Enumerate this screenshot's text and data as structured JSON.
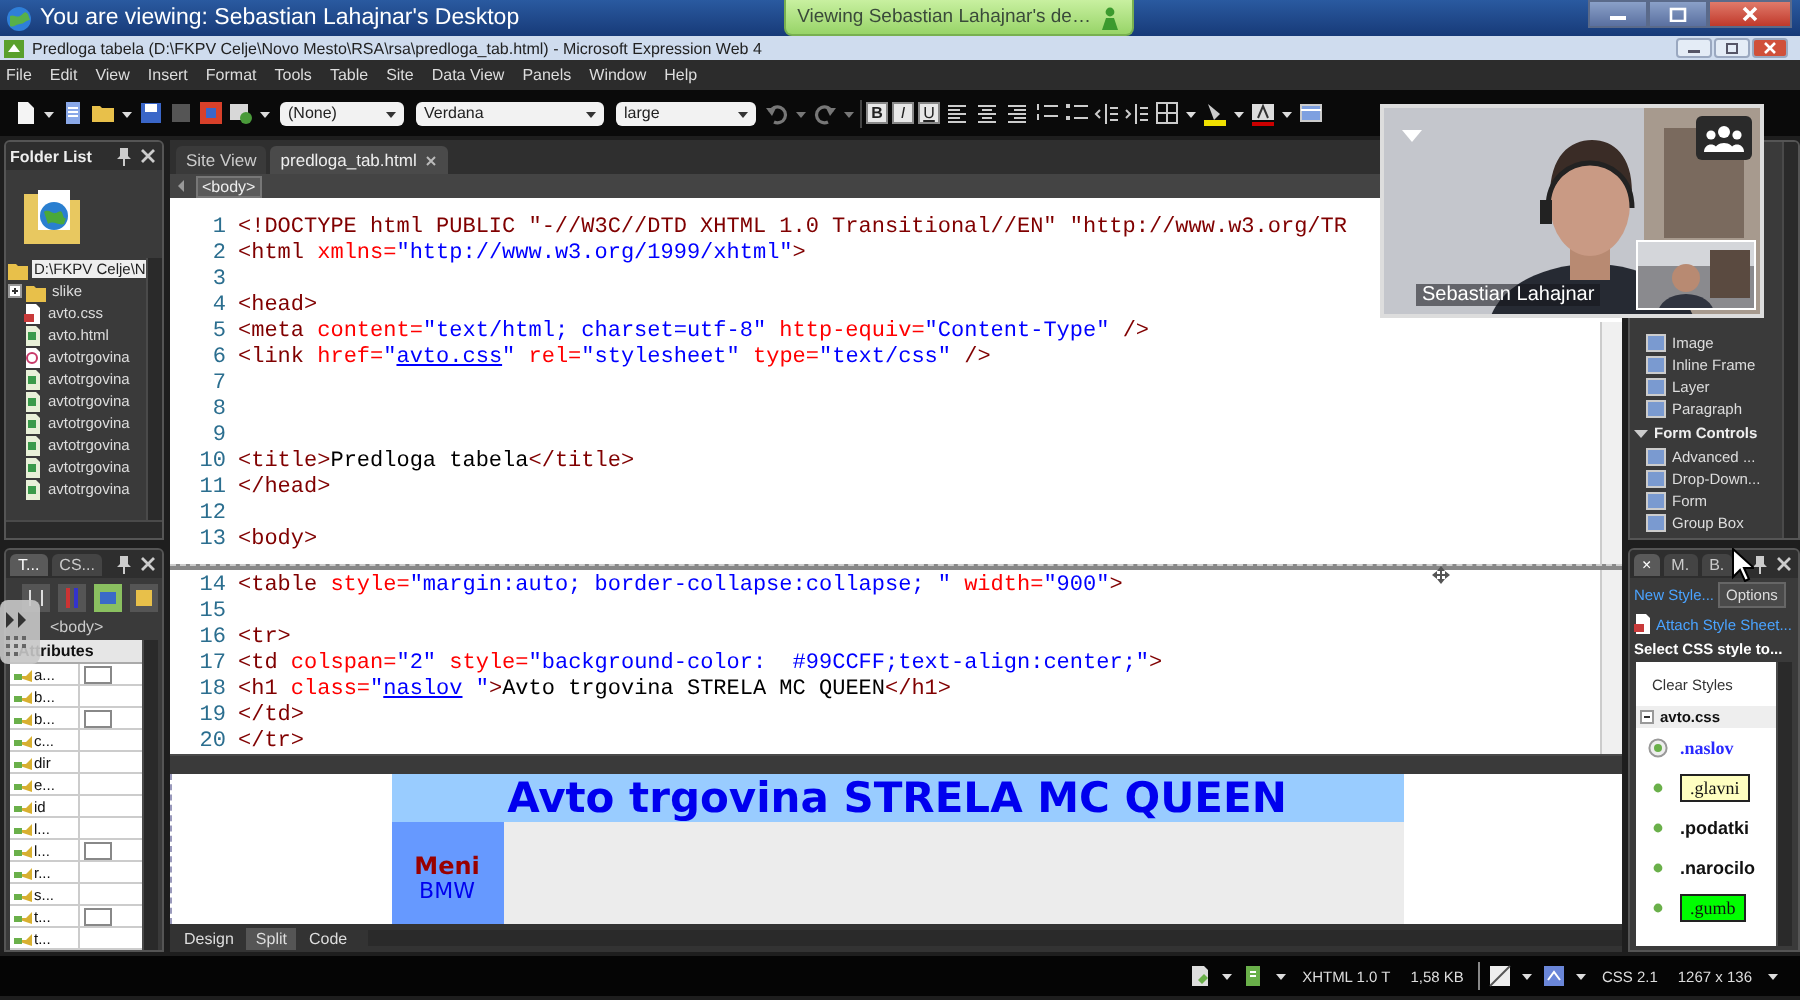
{
  "viewer_bar": {
    "title": "You are viewing: Sebastian Lahajnar's Desktop",
    "notification": "Viewing Sebastian Lahajnar's de…"
  },
  "window": {
    "title": "Predloga tabela (D:\\FKPV Celje\\Novo Mesto\\RSA\\rsa\\predloga_tab.html) - Microsoft Expression Web 4"
  },
  "menu": [
    "File",
    "Edit",
    "View",
    "Insert",
    "Format",
    "Tools",
    "Table",
    "Site",
    "Data View",
    "Panels",
    "Window",
    "Help"
  ],
  "toolbar": {
    "style": "(None)",
    "font": "Verdana",
    "size": "large",
    "format_buttons": [
      "B",
      "I",
      "U"
    ]
  },
  "folder_list": {
    "title": "Folder List",
    "items": [
      {
        "label": "D:\\FKPV Celje\\N",
        "kind": "root",
        "selected": true
      },
      {
        "label": "slike",
        "kind": "folder",
        "selected": false
      },
      {
        "label": "avto.css",
        "kind": "css",
        "selected": false
      },
      {
        "label": "avto.html",
        "kind": "html",
        "selected": false
      },
      {
        "label": "avtotrgovina",
        "kind": "other",
        "selected": false
      },
      {
        "label": "avtotrgovina",
        "kind": "html",
        "selected": false
      },
      {
        "label": "avtotrgovina",
        "kind": "html",
        "selected": false
      },
      {
        "label": "avtotrgovina",
        "kind": "html",
        "selected": false
      },
      {
        "label": "avtotrgovina",
        "kind": "html",
        "selected": false
      },
      {
        "label": "avtotrgovina",
        "kind": "html",
        "selected": false
      },
      {
        "label": "avtotrgovina",
        "kind": "html",
        "selected": false
      }
    ]
  },
  "tag_panel": {
    "tabs": [
      {
        "label": "T...",
        "selected": true
      },
      {
        "label": "CS...",
        "selected": false
      }
    ],
    "tag": "<body>",
    "column": "Attributes",
    "attributes": [
      {
        "name": "a...",
        "kind": "swatch"
      },
      {
        "name": "b...",
        "kind": "plain"
      },
      {
        "name": "b...",
        "kind": "swatch"
      },
      {
        "name": "c...",
        "kind": "plain"
      },
      {
        "name": "dir",
        "kind": "plain"
      },
      {
        "name": "e...",
        "kind": "plain"
      },
      {
        "name": "id",
        "kind": "plain"
      },
      {
        "name": "l...",
        "kind": "plain"
      },
      {
        "name": "l...",
        "kind": "swatch"
      },
      {
        "name": "r...",
        "kind": "plain"
      },
      {
        "name": "s...",
        "kind": "plain"
      },
      {
        "name": "t...",
        "kind": "swatch"
      },
      {
        "name": "t...",
        "kind": "plain"
      }
    ]
  },
  "editor": {
    "tabs": [
      {
        "label": "Site View",
        "selected": false
      },
      {
        "label": "predloga_tab.html",
        "selected": true
      }
    ],
    "breadcrumb": "<body>",
    "top_lines": [
      {
        "number": "1",
        "segments": [
          {
            "kind": "tag",
            "text": "<!DOCTYPE html PUBLIC \"-//W3C//DTD XHTML 1.0 Transitional//EN\" \"http://www.w3.org/TR"
          }
        ]
      },
      {
        "number": "2",
        "segments": [
          {
            "kind": "tag",
            "text": "<html"
          },
          {
            "kind": "attr",
            "text": " xmlns="
          },
          {
            "kind": "value",
            "text": "\"http://www.w3.org/1999/xhtml\""
          },
          {
            "kind": "tag",
            "text": ">"
          }
        ]
      },
      {
        "number": "3"
      },
      {
        "number": "4",
        "segments": [
          {
            "kind": "tag",
            "text": "<head>"
          }
        ]
      },
      {
        "number": "5",
        "segments": [
          {
            "kind": "tag",
            "text": "<meta"
          },
          {
            "kind": "attr",
            "text": " content="
          },
          {
            "kind": "value",
            "text": "\"text/html; charset=utf-8\""
          },
          {
            "kind": "attr",
            "text": " http-equiv="
          },
          {
            "kind": "value",
            "text": "\"Content-Type\""
          },
          {
            "kind": "tag",
            "text": " />"
          }
        ]
      },
      {
        "number": "6",
        "segments": [
          {
            "kind": "tag",
            "text": "<link"
          },
          {
            "kind": "attr",
            "text": " href="
          },
          {
            "kind": "value",
            "text": "\""
          },
          {
            "kind": "link",
            "text": "avto.css"
          },
          {
            "kind": "value",
            "text": "\""
          },
          {
            "kind": "attr",
            "text": " rel="
          },
          {
            "kind": "value",
            "text": "\"stylesheet\""
          },
          {
            "kind": "attr",
            "text": " type="
          },
          {
            "kind": "value",
            "text": "\"text/css\""
          },
          {
            "kind": "tag",
            "text": " />"
          }
        ]
      },
      {
        "number": "7"
      },
      {
        "number": "8"
      },
      {
        "number": "9"
      },
      {
        "number": "10",
        "segments": [
          {
            "kind": "tag",
            "text": "<title>"
          },
          {
            "kind": "text",
            "text": "Predloga tabela"
          },
          {
            "kind": "tag",
            "text": "</title>"
          }
        ]
      },
      {
        "number": "11",
        "segments": [
          {
            "kind": "tag",
            "text": "</head>"
          }
        ]
      },
      {
        "number": "12"
      },
      {
        "number": "13",
        "segments": [
          {
            "kind": "tag",
            "text": "<body>"
          }
        ]
      }
    ],
    "bottom_lines": [
      {
        "number": "14",
        "segments": [
          {
            "kind": "tag",
            "text": "<table"
          },
          {
            "kind": "attr",
            "text": " style="
          },
          {
            "kind": "value",
            "text": "\"margin:auto; border-collapse:collapse; \""
          },
          {
            "kind": "attr",
            "text": " width="
          },
          {
            "kind": "value",
            "text": "\"900\""
          },
          {
            "kind": "tag",
            "text": ">"
          }
        ]
      },
      {
        "number": "15"
      },
      {
        "number": "16",
        "segments": [
          {
            "kind": "tag",
            "text": "<tr>"
          }
        ]
      },
      {
        "number": "17",
        "segments": [
          {
            "kind": "tag",
            "text": "<td"
          },
          {
            "kind": "attr",
            "text": " colspan="
          },
          {
            "kind": "value",
            "text": "\"2\""
          },
          {
            "kind": "attr",
            "text": " style="
          },
          {
            "kind": "value",
            "text": "\"background-color:  #99CCFF;text-align:center;\""
          },
          {
            "kind": "tag",
            "text": ">"
          }
        ]
      },
      {
        "number": "18",
        "segments": [
          {
            "kind": "tag",
            "text": "<h1"
          },
          {
            "kind": "attr",
            "text": " class="
          },
          {
            "kind": "value",
            "text": "\""
          },
          {
            "kind": "link",
            "text": "naslov"
          },
          {
            "kind": "value",
            "text": " \""
          },
          {
            "kind": "tag",
            "text": ">"
          },
          {
            "kind": "text",
            "text": "Avto trgovina STRELA MC QUEEN"
          },
          {
            "kind": "tag",
            "text": "</h1>"
          }
        ]
      },
      {
        "number": "19",
        "segments": [
          {
            "kind": "tag",
            "text": "</td>"
          }
        ]
      },
      {
        "number": "20",
        "segments": [
          {
            "kind": "tag",
            "text": "</tr>"
          }
        ]
      }
    ],
    "design": {
      "heading": "Avto trgovina STRELA MC QUEEN",
      "menu_title": "Meni",
      "menu_items": [
        "BMW"
      ]
    },
    "view_tabs": [
      {
        "label": "Design",
        "selected": false
      },
      {
        "label": "Split",
        "selected": true
      },
      {
        "label": "Code",
        "selected": false
      }
    ]
  },
  "video": {
    "caption": "Sebastian Lahajnar"
  },
  "toolbox": {
    "items": [
      "Image",
      "Inline Frame",
      "Layer",
      "Paragraph"
    ],
    "groups": [
      {
        "label": "Form Controls",
        "expanded": true,
        "children": [
          "Advanced ...",
          "Drop-Down...",
          "Form",
          "Group Box"
        ]
      }
    ]
  },
  "styles_panel": {
    "tabs": [
      {
        "label": "×",
        "selected": true
      },
      {
        "label": "M.",
        "selected": false
      },
      {
        "label": "B.",
        "selected": false
      }
    ],
    "new_style": "New Style...",
    "options": "Options",
    "attach": "Attach Style Sheet...",
    "heading": "Select CSS style to...",
    "clear": "Clear Styles",
    "sheet": {
      "name": "avto.css",
      "expanded": true,
      "styles": [
        {
          "label": ".naslov",
          "kind": "title",
          "selected": true
        },
        {
          "label": ".glavni",
          "kind": "yellow-box",
          "selected": false
        },
        {
          "label": ".podatki",
          "kind": "plain",
          "selected": false
        },
        {
          "label": ".narocilo",
          "kind": "plain",
          "selected": false
        },
        {
          "label": ".gumb",
          "kind": "green-box",
          "selected": false
        }
      ]
    }
  },
  "status_bar": {
    "doctype": "XHTML 1.0 T",
    "size": "1,58 KB",
    "css": "CSS 2.1",
    "dimensions": "1267 x 136"
  }
}
